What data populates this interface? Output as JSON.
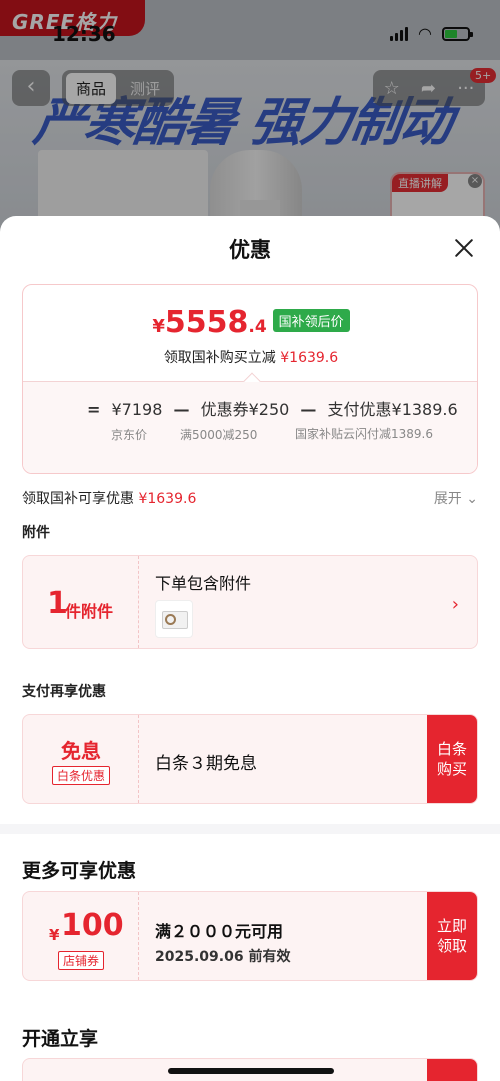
{
  "status_bar": {
    "time": "12:36",
    "brand_logo": "GREE格力"
  },
  "background": {
    "tabs": [
      "商品",
      "测评"
    ],
    "active_tab": "商品",
    "headline": "严寒酷暑 强力制动",
    "notification_badge": "5+",
    "live_tag": "直播讲解",
    "icons": [
      "back-icon",
      "star-icon",
      "share-icon",
      "more-icon"
    ]
  },
  "sheet": {
    "title": "优惠",
    "price": {
      "yen": "¥",
      "integer": "5558",
      "decimal": ".4",
      "tag": "国补领后价",
      "subline_text": "领取国补购买立减",
      "subline_amount": "¥1639.6"
    },
    "formula": {
      "eq": "=",
      "jd_price": "¥7198",
      "minus1": "—",
      "coupon": "优惠券¥250",
      "minus2": "—",
      "payment": "支付优惠¥1389.6",
      "cap_jd": "京东价",
      "cap_coupon": "满5000减250",
      "cap_gov": "国家补贴云闪付减1389.6"
    },
    "gov_row": {
      "text": "领取国补可享优惠",
      "amount": "¥1639.6",
      "expand": "展开"
    },
    "accessory": {
      "section": "附件",
      "count": "1",
      "unit": "件附件",
      "title": "下单包含附件"
    },
    "payment_offer": {
      "section": "支付再享优惠",
      "big": "免息",
      "tag": "白条优惠",
      "title": "白条３期免息",
      "cta": "白条购买"
    },
    "more": {
      "section": "更多可享优惠",
      "yen": "¥",
      "amount": "100",
      "tag": "店铺券",
      "line1": "满２０００元可用",
      "line2": "2025.09.06 前有效",
      "cta": "立即领取"
    },
    "open_section": "开通立享"
  },
  "colors": {
    "accent": "#e5252f",
    "green": "#2eaa4a",
    "pink_bg": "#fdf3f3"
  }
}
